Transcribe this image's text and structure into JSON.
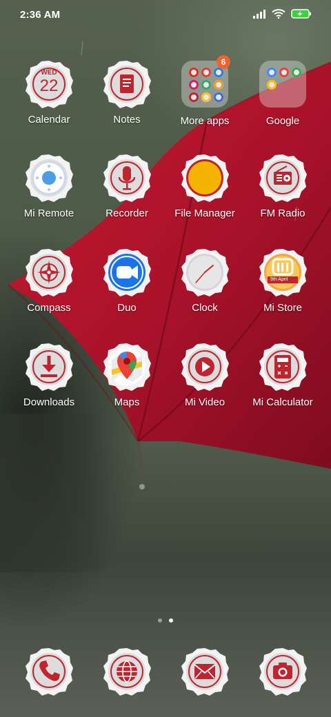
{
  "status_bar": {
    "time": "2:36 AM",
    "icons": [
      "signal-icon",
      "wifi-icon",
      "battery-charging-icon"
    ],
    "battery_color": "#3ad13a"
  },
  "theme": {
    "accent": "#c0242f",
    "icon_rim": "#f2f2f2",
    "umbrella": "#b8152a"
  },
  "apps": [
    {
      "label": "Calendar",
      "icon": "calendar-icon",
      "date_day": "WED",
      "date_num": "22"
    },
    {
      "label": "Notes",
      "icon": "notes-icon"
    },
    {
      "label": "More apps",
      "icon": "folder-icon",
      "badge": "6"
    },
    {
      "label": "Google",
      "icon": "folder-icon"
    },
    {
      "label": "Mi Remote",
      "icon": "remote-icon"
    },
    {
      "label": "Recorder",
      "icon": "microphone-icon"
    },
    {
      "label": "File Manager",
      "icon": "file-manager-icon"
    },
    {
      "label": "FM Radio",
      "icon": "radio-icon"
    },
    {
      "label": "Compass",
      "icon": "compass-icon"
    },
    {
      "label": "Duo",
      "icon": "video-camera-icon"
    },
    {
      "label": "Clock",
      "icon": "clock-icon"
    },
    {
      "label": "Mi Store",
      "icon": "mi-store-icon",
      "banner_text": "9th April"
    },
    {
      "label": "Downloads",
      "icon": "download-icon"
    },
    {
      "label": "Maps",
      "icon": "map-pin-icon"
    },
    {
      "label": "Mi Video",
      "icon": "play-icon"
    },
    {
      "label": "Mi Calculator",
      "icon": "calculator-icon"
    }
  ],
  "page_indicator": {
    "pages": 2,
    "current": 2
  },
  "dock": [
    {
      "icon": "phone-icon"
    },
    {
      "icon": "globe-icon"
    },
    {
      "icon": "mail-icon"
    },
    {
      "icon": "camera-icon"
    }
  ]
}
